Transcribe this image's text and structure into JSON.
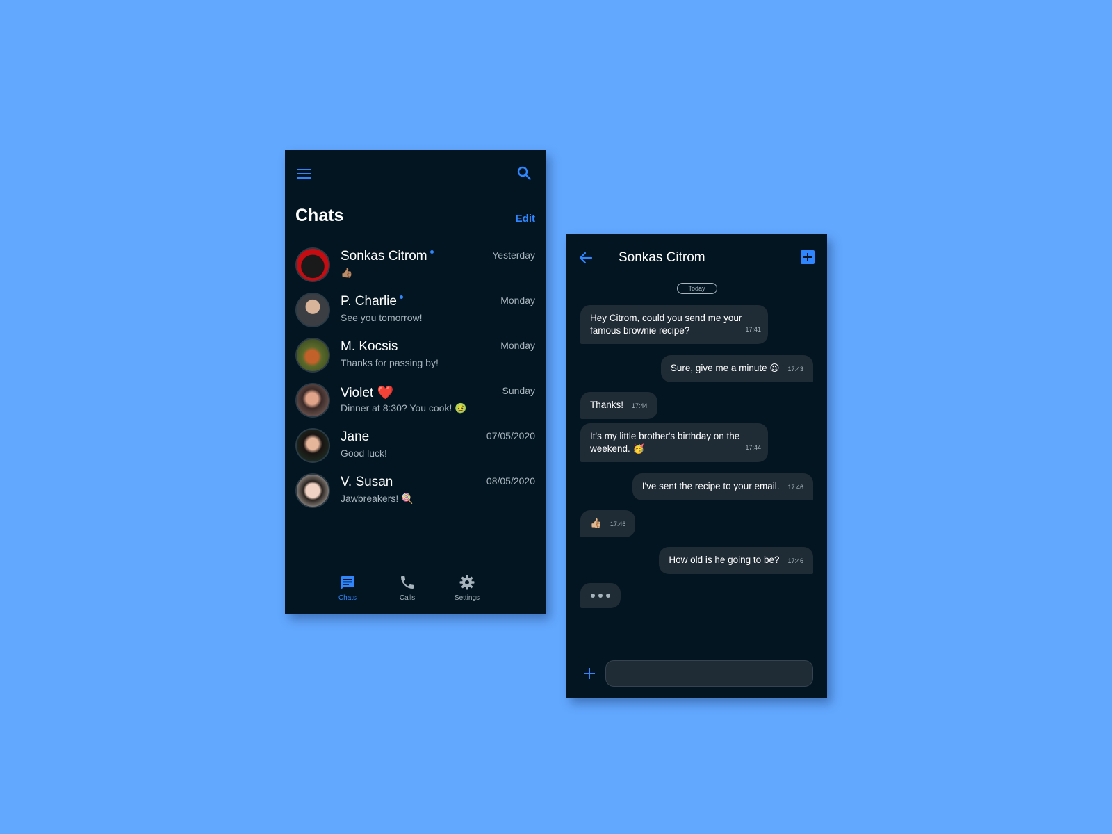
{
  "colors": {
    "background": "#62a8ff",
    "screen": "#021520",
    "accent": "#2f86ff",
    "bubble": "#1f2b35",
    "muted_text": "#a7b3bd"
  },
  "list_screen": {
    "title": "Chats",
    "edit_label": "Edit",
    "menu_icon": "hamburger-menu-icon",
    "search_icon": "search-icon",
    "chats": [
      {
        "name": "Sonkas Citrom",
        "preview": "👍🏽",
        "date": "Yesterday",
        "unread": true
      },
      {
        "name": "P. Charlie",
        "preview": "See you tomorrow!",
        "date": "Monday",
        "unread": true
      },
      {
        "name": "M. Kocsis",
        "preview": "Thanks for passing by!",
        "date": "Monday",
        "unread": false
      },
      {
        "name": "Violet ❤️",
        "preview": "Dinner at 8:30? You cook! 🤢",
        "date": "Sunday",
        "unread": false
      },
      {
        "name": "Jane",
        "preview": "Good luck!",
        "date": "07/05/2020",
        "unread": false
      },
      {
        "name": "V. Susan",
        "preview": "Jawbreakers! 🍭",
        "date": "08/05/2020",
        "unread": false
      }
    ],
    "tabs": [
      {
        "label": "Chats",
        "icon": "chat-bubble-icon",
        "active": true
      },
      {
        "label": "Calls",
        "icon": "phone-icon",
        "active": false
      },
      {
        "label": "Settings",
        "icon": "gear-icon",
        "active": false
      }
    ]
  },
  "conversation": {
    "contact_name": "Sonkas Citrom",
    "back_icon": "arrow-left-icon",
    "add_icon": "plus-square-icon",
    "date_label": "Today",
    "messages": [
      {
        "dir": "in",
        "text": "Hey Citrom, could you send me your famous brownie recipe?",
        "time": "17:41"
      },
      {
        "dir": "out",
        "text": "Sure, give me a minute 😉",
        "time": "17:43"
      },
      {
        "dir": "in",
        "text": "Thanks!",
        "time": "17:44"
      },
      {
        "dir": "in",
        "text": "It's my little brother's birthday on the weekend. 🥳",
        "time": "17:44"
      },
      {
        "dir": "out",
        "text": "I've sent the recipe to your email.",
        "time": "17:46"
      },
      {
        "dir": "in",
        "text": "👍🏼",
        "time": "17:46"
      },
      {
        "dir": "out",
        "text": "How old is he going to be?",
        "time": "17:46"
      }
    ],
    "typing_indicator": true,
    "attach_icon": "plus-icon",
    "input_value": "",
    "input_placeholder": ""
  }
}
